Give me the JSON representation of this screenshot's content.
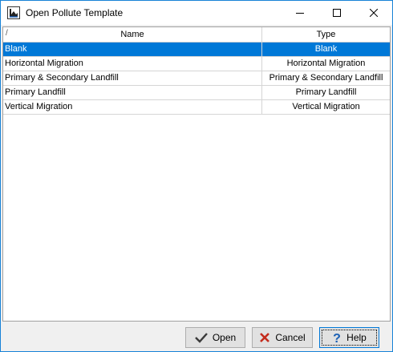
{
  "window": {
    "title": "Open Pollute Template",
    "icons": {
      "app": "pollute-app-icon",
      "minimize": "minimize-icon",
      "maximize": "maximize-icon",
      "close": "close-icon"
    }
  },
  "table": {
    "sort_indicator": "/",
    "columns": {
      "name": "Name",
      "type": "Type"
    },
    "rows": [
      {
        "name": "Blank",
        "type": "Blank",
        "selected": true
      },
      {
        "name": "Horizontal Migration",
        "type": "Horizontal Migration",
        "selected": false
      },
      {
        "name": "Primary & Secondary Landfill",
        "type": "Primary & Secondary Landfill",
        "selected": false
      },
      {
        "name": "Primary Landfill",
        "type": "Primary Landfill",
        "selected": false
      },
      {
        "name": "Vertical Migration",
        "type": "Vertical Migration",
        "selected": false
      }
    ],
    "colors": {
      "selection": "#0078d7"
    }
  },
  "buttons": {
    "open": {
      "label": "Open",
      "icon": "checkmark-icon"
    },
    "cancel": {
      "label": "Cancel",
      "icon": "x-icon"
    },
    "help": {
      "label": "Help",
      "icon": "question-mark-icon"
    }
  }
}
